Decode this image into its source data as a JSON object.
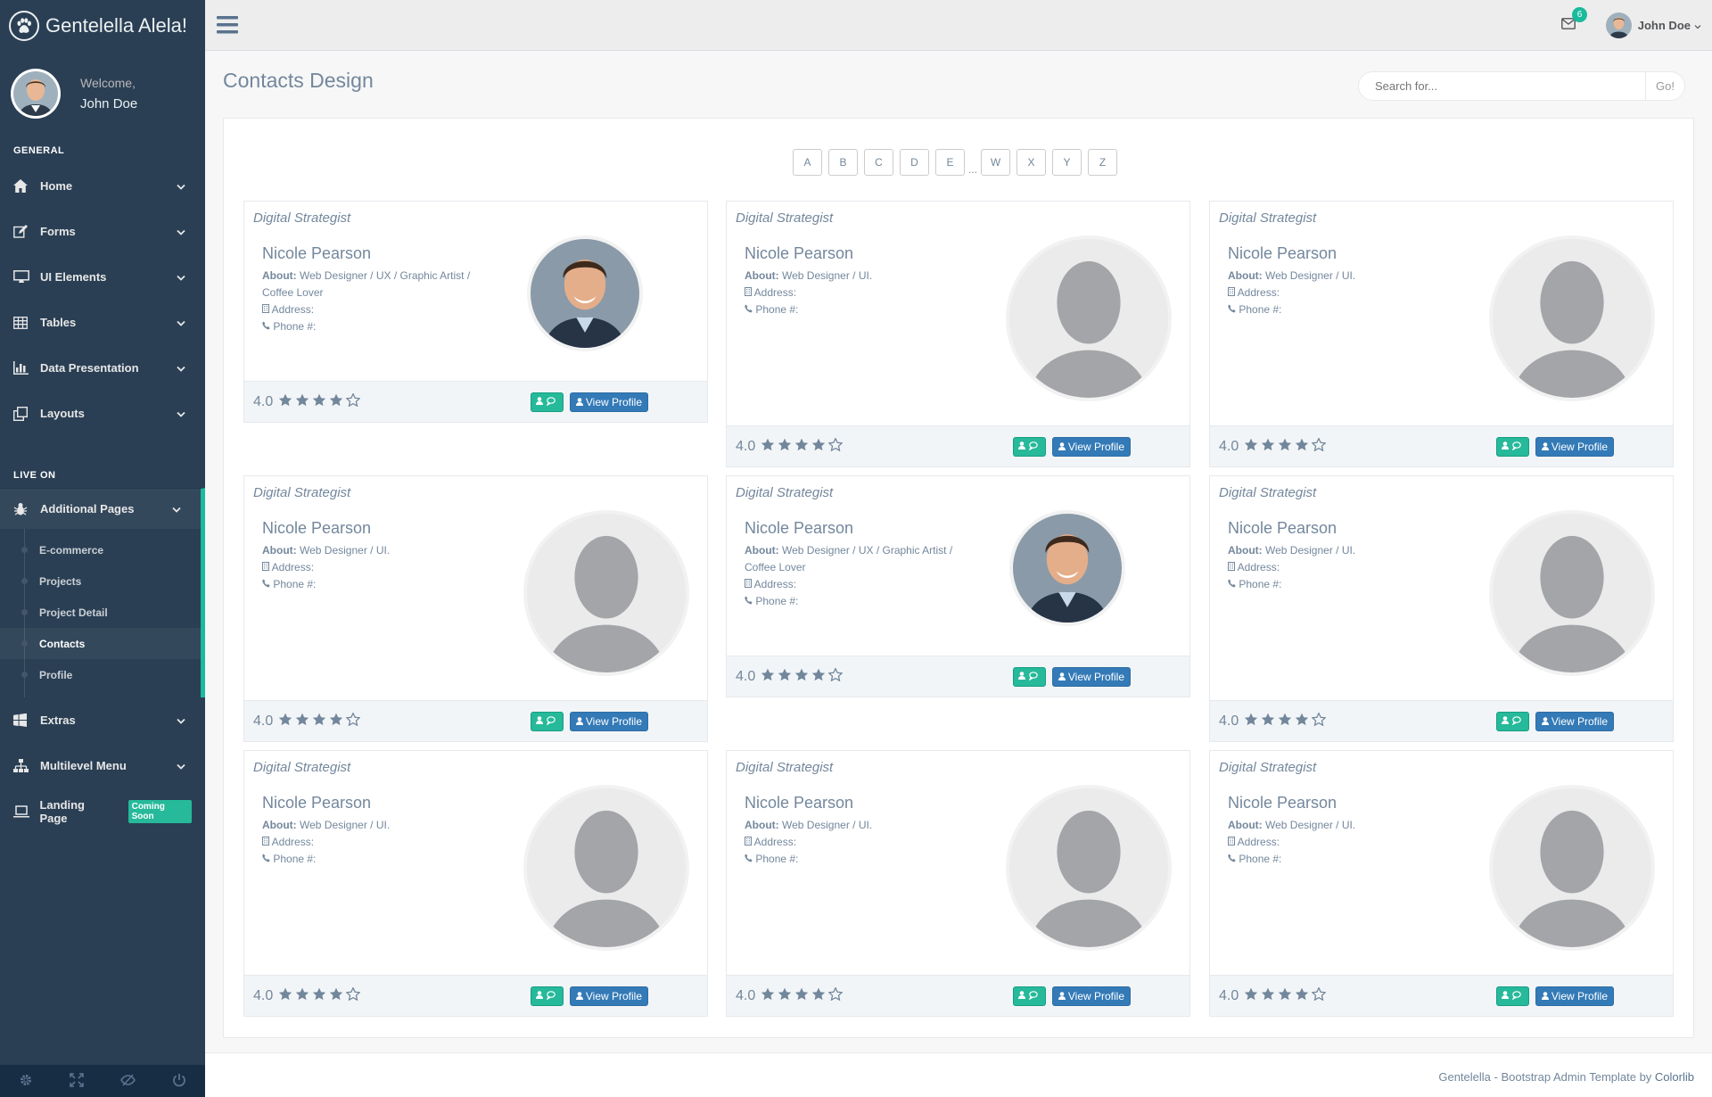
{
  "brand": {
    "title": "Gentelella Alela!"
  },
  "profile": {
    "welcome": "Welcome,",
    "name": "John Doe"
  },
  "sidebar": {
    "general_title": "GENERAL",
    "general_items": [
      {
        "label": "Home",
        "icon": "home-icon"
      },
      {
        "label": "Forms",
        "icon": "edit-icon"
      },
      {
        "label": "UI Elements",
        "icon": "desktop-icon"
      },
      {
        "label": "Tables",
        "icon": "table-icon"
      },
      {
        "label": "Data Presentation",
        "icon": "bar-chart-icon"
      },
      {
        "label": "Layouts",
        "icon": "clone-icon"
      }
    ],
    "live_title": "LIVE ON",
    "additional_pages": {
      "label": "Additional Pages",
      "icon": "bug-icon"
    },
    "sub_items": [
      "E-commerce",
      "Projects",
      "Project Detail",
      "Contacts",
      "Profile"
    ],
    "active_sub": "Contacts",
    "extras": {
      "label": "Extras",
      "icon": "windows-icon"
    },
    "multilevel": {
      "label": "Multilevel Menu",
      "icon": "sitemap-icon"
    },
    "landing": {
      "label": "Landing Page",
      "icon": "laptop-icon",
      "badge": "Coming Soon"
    }
  },
  "topnav": {
    "mail_count": "6",
    "user_name": "John Doe"
  },
  "page": {
    "title": "Contacts Design",
    "search_placeholder": "Search for...",
    "search_button": "Go!"
  },
  "alphabet": {
    "first": [
      "A",
      "B",
      "C",
      "D",
      "E"
    ],
    "dots": "...",
    "last": [
      "W",
      "X",
      "Y",
      "Z"
    ]
  },
  "contacts": [
    {
      "role": "Digital Strategist",
      "name": "Nicole Pearson",
      "about_label": "About:",
      "about": "Web Designer / UX / Graphic Artist / Coffee Lover",
      "address": "Address:",
      "phone": "Phone #:",
      "rating": "4.0",
      "stars": 4,
      "photo": "real",
      "view": "View Profile"
    },
    {
      "role": "Digital Strategist",
      "name": "Nicole Pearson",
      "about_label": "About:",
      "about": "Web Designer / UI.",
      "address": "Address:",
      "phone": "Phone #:",
      "rating": "4.0",
      "stars": 4,
      "photo": "placeholder",
      "view": "View Profile"
    },
    {
      "role": "Digital Strategist",
      "name": "Nicole Pearson",
      "about_label": "About:",
      "about": "Web Designer / UI.",
      "address": "Address:",
      "phone": "Phone #:",
      "rating": "4.0",
      "stars": 4,
      "photo": "placeholder",
      "view": "View Profile"
    },
    {
      "role": "Digital Strategist",
      "name": "Nicole Pearson",
      "about_label": "About:",
      "about": "Web Designer / UI.",
      "address": "Address:",
      "phone": "Phone #:",
      "rating": "4.0",
      "stars": 4,
      "photo": "placeholder",
      "view": "View Profile"
    },
    {
      "role": "Digital Strategist",
      "name": "Nicole Pearson",
      "about_label": "About:",
      "about": "Web Designer / UX / Graphic Artist / Coffee Lover",
      "address": "Address:",
      "phone": "Phone #:",
      "rating": "4.0",
      "stars": 4,
      "photo": "real",
      "view": "View Profile"
    },
    {
      "role": "Digital Strategist",
      "name": "Nicole Pearson",
      "about_label": "About:",
      "about": "Web Designer / UI.",
      "address": "Address:",
      "phone": "Phone #:",
      "rating": "4.0",
      "stars": 4,
      "photo": "placeholder",
      "view": "View Profile"
    },
    {
      "role": "Digital Strategist",
      "name": "Nicole Pearson",
      "about_label": "About:",
      "about": "Web Designer / UI.",
      "address": "Address:",
      "phone": "Phone #:",
      "rating": "4.0",
      "stars": 4,
      "photo": "placeholder",
      "view": "View Profile"
    },
    {
      "role": "Digital Strategist",
      "name": "Nicole Pearson",
      "about_label": "About:",
      "about": "Web Designer / UI.",
      "address": "Address:",
      "phone": "Phone #:",
      "rating": "4.0",
      "stars": 4,
      "photo": "placeholder",
      "view": "View Profile"
    },
    {
      "role": "Digital Strategist",
      "name": "Nicole Pearson",
      "about_label": "About:",
      "about": "Web Designer / UI.",
      "address": "Address:",
      "phone": "Phone #:",
      "rating": "4.0",
      "stars": 4,
      "photo": "placeholder",
      "view": "View Profile"
    }
  ],
  "footer": {
    "text": "Gentelella - Bootstrap Admin Template by ",
    "link": "Colorlib"
  },
  "colors": {
    "sidebar": "#2a3f54",
    "accent": "#1abb9c",
    "primary": "#337ab7",
    "success": "#26b99a"
  }
}
